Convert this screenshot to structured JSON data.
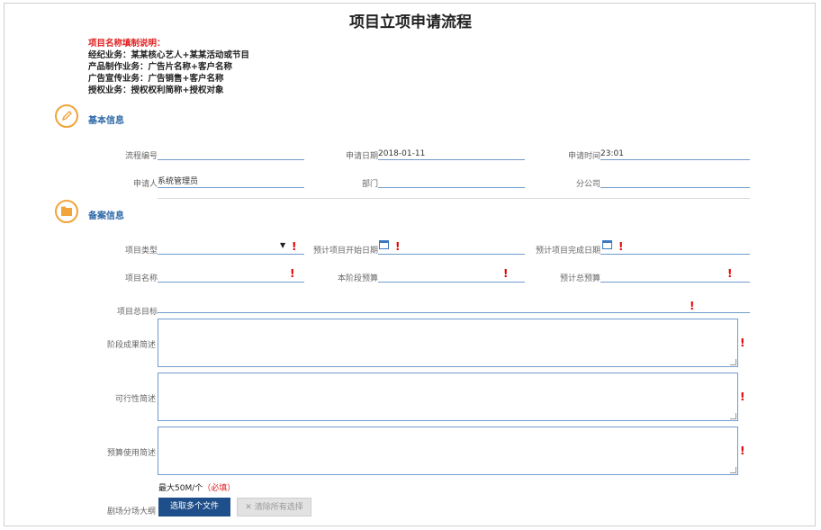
{
  "page": {
    "title": "项目立项申请流程"
  },
  "notes": {
    "heading": "项目名称填制说明：",
    "lines": [
      "经纪业务：某某核心艺人+某某活动或节目",
      "产品制作业务：广告片名称+客户名称",
      "广告宣传业务：广告销售+客户名称",
      "授权业务：授权权利简称+授权对象"
    ]
  },
  "basic": {
    "title": "基本信息",
    "fields": {
      "flow_no_label": "流程编号",
      "flow_no_value": "",
      "apply_date_label": "申请日期",
      "apply_date_value": "2018-01-11",
      "apply_time_label": "申请时间",
      "apply_time_value": "23:01",
      "applicant_label": "申请人",
      "applicant_value": "系统管理员",
      "dept_label": "部门",
      "dept_value": "",
      "branch_label": "分公司",
      "branch_value": ""
    }
  },
  "record": {
    "title": "备案信息",
    "fields": {
      "type_label": "项目类型",
      "type_value": "",
      "start_label": "预计项目开始日期",
      "end_label": "预计项目完成日期",
      "name_label": "项目名称",
      "stage_budget_label": "本阶段预算",
      "total_budget_label": "预计总预算",
      "goal_label": "项目总目标",
      "stage_desc_label": "阶段成果简述",
      "feasibility_label": "可行性简述",
      "budget_use_label": "预算使用简述"
    },
    "upload": {
      "hint": "最大50M/个",
      "required": "（必填）",
      "label": "剧场分场大纲",
      "select_button": "选取多个文件",
      "clear_button": "清除所有选择",
      "clear_icon": "close-icon"
    },
    "required_mark": "!",
    "colors": {
      "required": "#e00000",
      "accent": "#1f4f8a",
      "section": "#f0a43a"
    }
  }
}
